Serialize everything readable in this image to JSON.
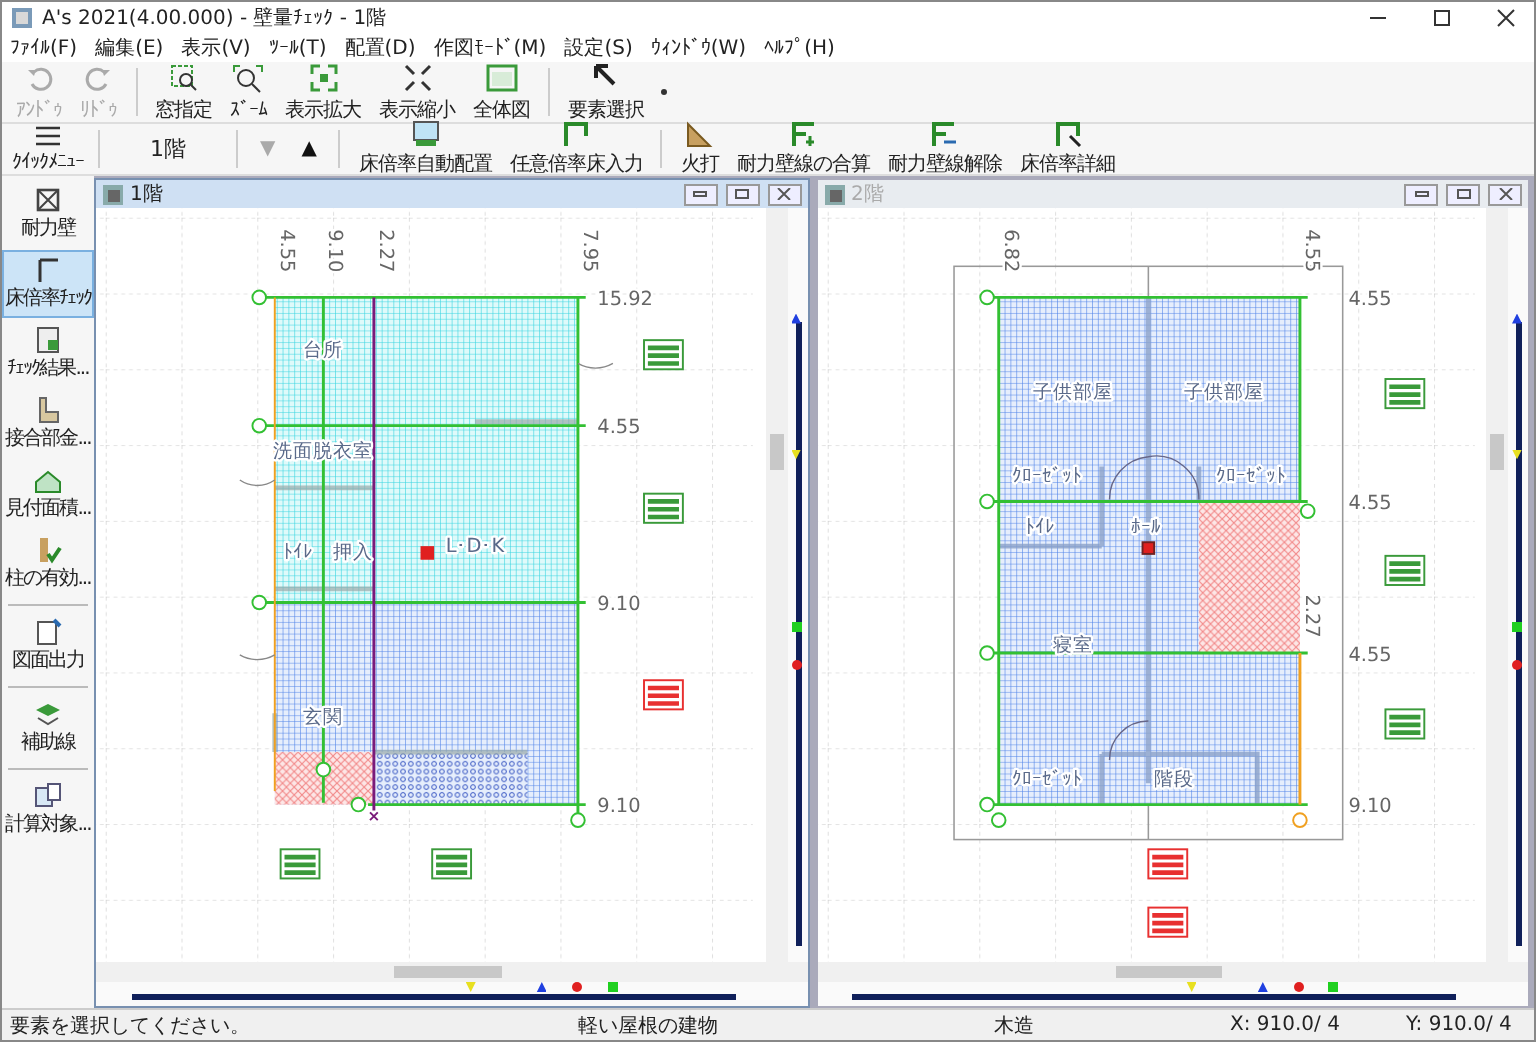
{
  "window": {
    "title": "A's 2021(4.00.000) - 壁量ﾁｪｯｸ - 1階"
  },
  "menu": [
    "ﾌｧｲﾙ(F)",
    "編集(E)",
    "表示(V)",
    "ﾂｰﾙ(T)",
    "配置(D)",
    "作図ﾓｰﾄﾞ(M)",
    "設定(S)",
    "ｳｨﾝﾄﾞｳ(W)",
    "ﾍﾙﾌﾟ(H)"
  ],
  "toolbar": [
    {
      "label": "ｱﾝﾄﾞｩ",
      "kind": "undo",
      "disabled": true
    },
    {
      "label": "ﾘﾄﾞｩ",
      "kind": "redo",
      "disabled": true
    },
    {
      "label": "窓指定",
      "kind": "window-zoom",
      "disabled": false
    },
    {
      "label": "ｽﾞｰﾑ",
      "kind": "zoom",
      "disabled": false
    },
    {
      "label": "表示拡大",
      "kind": "expand",
      "disabled": false
    },
    {
      "label": "表示縮小",
      "kind": "shrink",
      "disabled": false
    },
    {
      "label": "全体図",
      "kind": "whole",
      "disabled": false
    },
    {
      "label": "要素選択",
      "kind": "select",
      "disabled": false
    }
  ],
  "floor_toolbar": {
    "quick_menu": "ｸｲｯｸﾒﾆｭｰ",
    "floor": "1階",
    "prev": {
      "label": "▼",
      "disabled": true
    },
    "next": {
      "label": "▲",
      "disabled": false
    },
    "tools": [
      {
        "label": "床倍率自動配置",
        "kind": "auto"
      },
      {
        "label": "任意倍率床入力",
        "kind": "floor"
      },
      {
        "label": "火打",
        "kind": "brace"
      },
      {
        "label": "耐力壁線の合算",
        "kind": "sum"
      },
      {
        "label": "耐力壁線解除",
        "kind": "release"
      },
      {
        "label": "床倍率詳細",
        "kind": "detail"
      }
    ]
  },
  "sidebar": [
    {
      "label": "耐力壁",
      "kind": "wall",
      "selected": false
    },
    {
      "label": "床倍率ﾁｪｯｸ",
      "kind": "floor",
      "selected": true
    },
    {
      "label": "ﾁｪｯｸ結果...",
      "kind": "result",
      "selected": false
    },
    {
      "label": "接合部金...",
      "kind": "joint",
      "selected": false
    },
    {
      "label": "見付面積...",
      "kind": "area",
      "selected": false
    },
    {
      "label": "柱の有効...",
      "kind": "column",
      "selected": false
    },
    {
      "label": "図面出力",
      "kind": "output",
      "selected": false
    },
    {
      "label": "補助線",
      "kind": "guide",
      "selected": false
    },
    {
      "label": "計算対象...",
      "kind": "target",
      "selected": false
    }
  ],
  "panes": [
    {
      "title": "1階",
      "active": true,
      "axis_labels": [
        "4.55",
        "9.10",
        "2.27",
        "7.95"
      ],
      "level_labels": [
        "15.92",
        "4.55",
        "9.10",
        "9.10"
      ],
      "rooms": [
        "台所",
        "洗面脱衣室",
        "ﾄｲﾚ",
        "押入",
        "L･D･K",
        "玄関"
      ],
      "tags": [
        {
          "kind": "ok"
        },
        {
          "kind": "ok"
        },
        {
          "kind": "ng"
        },
        {
          "kind": "ok"
        },
        {
          "kind": "ok"
        }
      ]
    },
    {
      "title": "2階",
      "active": false,
      "axis_labels": [
        "6.82",
        "4.55",
        "2.27"
      ],
      "level_labels": [
        "4.55",
        "4.55",
        "4.55",
        "9.10"
      ],
      "rooms": [
        "子供部屋",
        "子供部屋",
        "ｸﾛｰｾﾞｯﾄ",
        "ｸﾛｰｾﾞｯﾄ",
        "ﾄｲﾚ",
        "ﾎｰﾙ",
        "寝室",
        "ｸﾛｰｾﾞｯﾄ",
        "階段"
      ],
      "tags": [
        {
          "kind": "ok"
        },
        {
          "kind": "ok"
        },
        {
          "kind": "ok"
        },
        {
          "kind": "ng"
        },
        {
          "kind": "ng"
        }
      ]
    }
  ],
  "status_bar": [
    "要素を選択してください。",
    "軽い屋根の建物",
    "木造",
    "X: 910.0/ 4",
    "Y: 910.0/ 4"
  ]
}
